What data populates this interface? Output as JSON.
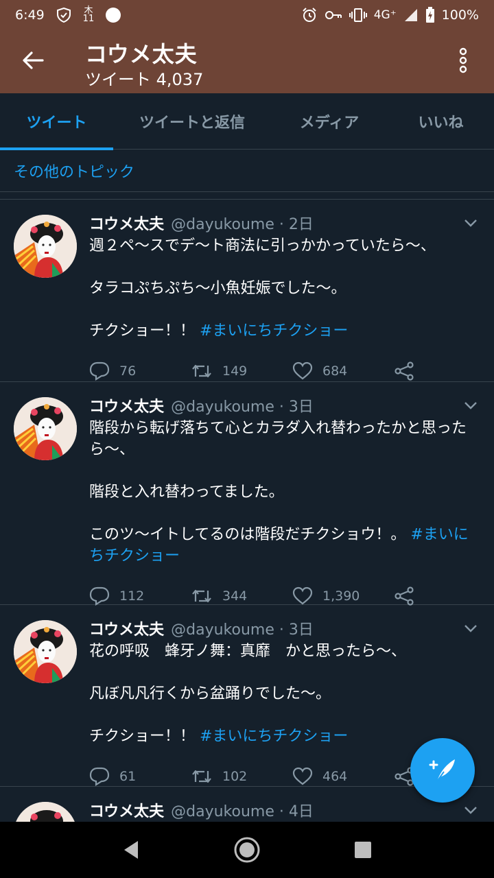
{
  "status_bar": {
    "time": "6:49",
    "calendar_label": "木",
    "calendar_day": "11",
    "network": "4G⁺",
    "battery": "100%"
  },
  "header": {
    "title": "コウメ太夫",
    "subtitle": "ツイート 4,037"
  },
  "tabs": [
    {
      "label": "ツイート",
      "active": true
    },
    {
      "label": "ツイートと返信",
      "active": false
    },
    {
      "label": "メディア",
      "active": false
    },
    {
      "label": "いいね",
      "active": false
    }
  ],
  "topics_link": "その他のトピック",
  "tweets": [
    {
      "name": "コウメ太夫",
      "meta": "@dayukoume · 2日",
      "text": "週２ペ〜スでデ〜ト商法に引っかかっていたら〜、\n\nタラコぷちぷち〜小魚妊娠でした〜。\n\nチクショー！！ ",
      "hashtag": "#まいにちチクショー",
      "replies": "76",
      "retweets": "149",
      "likes": "684"
    },
    {
      "name": "コウメ太夫",
      "meta": "@dayukoume · 3日",
      "text": "階段から転げ落ちて心とカラダ入れ替わったかと思ったら〜、\n\n階段と入れ替わってました。\n\nこのツ〜イトしてるのは階段だチクショウ！。 ",
      "hashtag": "#まいにちチクショー",
      "replies": "112",
      "retweets": "344",
      "likes": "1,390"
    },
    {
      "name": "コウメ太夫",
      "meta": "@dayukoume · 3日",
      "text": "花の呼吸　蜂牙ノ舞：真靡　かと思ったら〜、\n\n凡ぼ凡凡行くから盆踊りでした〜。\n\nチクショー！！ ",
      "hashtag": "#まいにちチクショー",
      "replies": "61",
      "retweets": "102",
      "likes": "464"
    },
    {
      "name": "コウメ太夫",
      "meta": "@dayukoume · 4日",
      "text": "",
      "hashtag": "",
      "replies": "",
      "retweets": "",
      "likes": ""
    }
  ],
  "icons": {
    "back": "arrow-left-icon",
    "more": "more-vertical-icon",
    "reply": "comment-icon",
    "retweet": "retweet-icon",
    "like": "heart-icon",
    "share": "share-icon",
    "compose": "compose-tweet-icon"
  },
  "colors": {
    "header_bg": "#6e4436",
    "page_bg": "#15202b",
    "accent": "#1da1f2",
    "muted": "#8899a6"
  }
}
